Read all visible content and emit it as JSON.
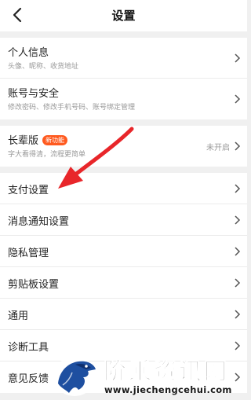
{
  "header": {
    "title": "设置"
  },
  "groups": [
    {
      "items": [
        {
          "label": "个人信息",
          "sub": "头像、昵称、收货地址"
        },
        {
          "label": "账号与安全",
          "sub": "修改密码、修改手机号码、账号绑定管理"
        }
      ]
    },
    {
      "items": [
        {
          "label": "长辈版",
          "badge": "新功能",
          "sub": "字大看得清，流程更简单",
          "right_text": "未开启"
        }
      ]
    },
    {
      "items": [
        {
          "label": "支付设置"
        },
        {
          "label": "消息通知设置"
        },
        {
          "label": "隐私管理"
        },
        {
          "label": "剪贴板设置"
        },
        {
          "label": "通用"
        },
        {
          "label": "诊断工具"
        },
        {
          "label": "意见反馈"
        }
      ]
    }
  ],
  "icons": {
    "back": "chevron-left-icon",
    "row_arrow": "chevron-right-icon",
    "annotation": "red-arrow-icon"
  },
  "colors": {
    "badge": "#ff5a1f",
    "annotation_arrow": "#e8262a",
    "watermark_logo": "#1e4fa0"
  },
  "watermark": {
    "title": "阶乘资讯网",
    "url": "www.jiechengcehui.com"
  }
}
